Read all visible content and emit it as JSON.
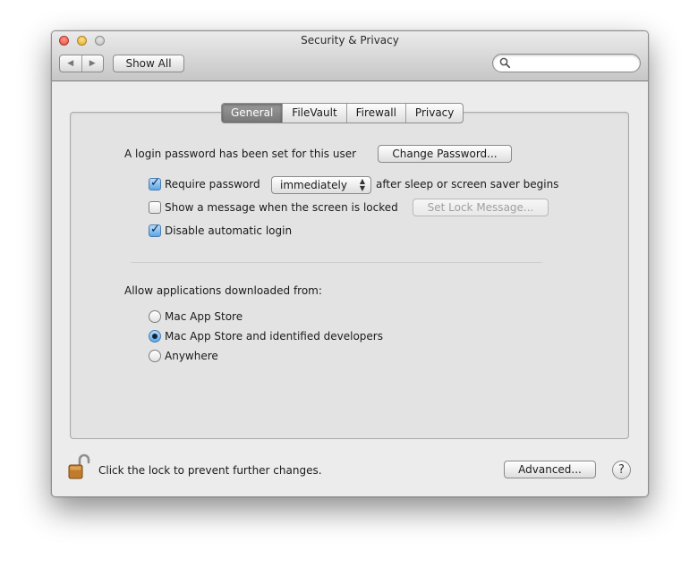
{
  "window": {
    "title": "Security & Privacy"
  },
  "toolbar": {
    "show_all_label": "Show All",
    "search_placeholder": ""
  },
  "tabs": [
    {
      "label": "General",
      "active": true
    },
    {
      "label": "FileVault",
      "active": false
    },
    {
      "label": "Firewall",
      "active": false
    },
    {
      "label": "Privacy",
      "active": false
    }
  ],
  "general": {
    "password_set_text": "A login password has been set for this user",
    "change_password_label": "Change Password...",
    "require_password": {
      "label": "Require password",
      "checked": true,
      "selected_option": "immediately",
      "suffix": "after sleep or screen saver begins"
    },
    "show_message": {
      "label": "Show a message when the screen is locked",
      "checked": false,
      "button_label": "Set Lock Message..."
    },
    "disable_auto_login": {
      "label": "Disable automatic login",
      "checked": true
    },
    "allow_apps": {
      "heading": "Allow applications downloaded from:",
      "options": [
        {
          "label": "Mac App Store",
          "selected": false
        },
        {
          "label": "Mac App Store and identified developers",
          "selected": true
        },
        {
          "label": "Anywhere",
          "selected": false
        }
      ]
    }
  },
  "footer": {
    "lock_text": "Click the lock to prevent further changes.",
    "advanced_label": "Advanced...",
    "help_label": "?"
  },
  "colors": {
    "window_bg": "#ececec",
    "checkbox_checked": "#5da6e8",
    "tab_active": "#888888"
  }
}
